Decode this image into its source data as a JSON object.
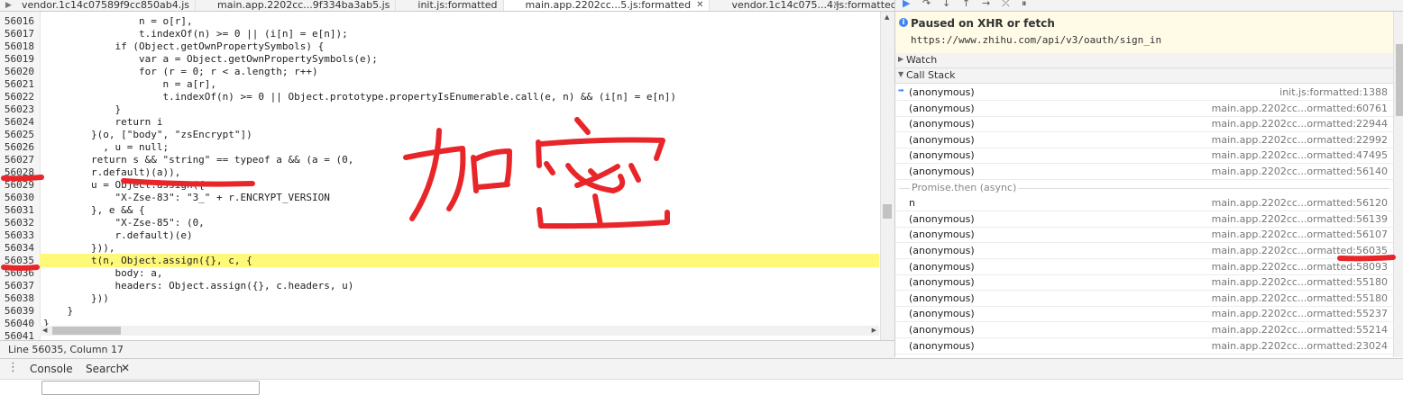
{
  "tabs": [
    {
      "label": "vendor.1c14c07589f9cc850ab4.js",
      "active": false
    },
    {
      "label": "main.app.2202cc...9f334ba3ab5.js",
      "active": false
    },
    {
      "label": "init.js:formatted",
      "active": false
    },
    {
      "label": "main.app.2202cc...5.js:formatted",
      "active": true
    },
    {
      "label": "vendor.1c14c075...4.js:formatted",
      "active": false
    }
  ],
  "code_lines": [
    {
      "num": "56016",
      "text": "                n = o[r],"
    },
    {
      "num": "56017",
      "text": "                t.indexOf(n) >= 0 || (i[n] = e[n]);"
    },
    {
      "num": "56018",
      "text": "            if (Object.getOwnPropertySymbols) {"
    },
    {
      "num": "56019",
      "text": "                var a = Object.getOwnPropertySymbols(e);"
    },
    {
      "num": "56020",
      "text": "                for (r = 0; r < a.length; r++)"
    },
    {
      "num": "56021",
      "text": "                    n = a[r],"
    },
    {
      "num": "56022",
      "text": "                    t.indexOf(n) >= 0 || Object.prototype.propertyIsEnumerable.call(e, n) && (i[n] = e[n])"
    },
    {
      "num": "56023",
      "text": "            }"
    },
    {
      "num": "56024",
      "text": "            return i"
    },
    {
      "num": "56025",
      "text": "        }(o, [\"body\", \"zsEncrypt\"])"
    },
    {
      "num": "56026",
      "text": "          , u = null;"
    },
    {
      "num": "56027",
      "text": "        return s && \"string\" == typeof a && (a = (0,"
    },
    {
      "num": "56028",
      "text": "        r.default)(a)),"
    },
    {
      "num": "56029",
      "text": "        u = Object.assign({"
    },
    {
      "num": "56030",
      "text": "            \"X-Zse-83\": \"3_\" + r.ENCRYPT_VERSION"
    },
    {
      "num": "56031",
      "text": "        }, e && {"
    },
    {
      "num": "56032",
      "text": "            \"X-Zse-85\": (0,"
    },
    {
      "num": "56033",
      "text": "            r.default)(e)"
    },
    {
      "num": "56034",
      "text": "        })),"
    },
    {
      "num": "56035",
      "text": "        t(n, Object.assign({}, c, {"
    },
    {
      "num": "56036",
      "text": "            body: a,"
    },
    {
      "num": "56037",
      "text": "            headers: Object.assign({}, c.headers, u)"
    },
    {
      "num": "56038",
      "text": "        }))"
    },
    {
      "num": "56039",
      "text": "    }"
    },
    {
      "num": "56040",
      "text": "}"
    },
    {
      "num": "56041",
      "text": ""
    }
  ],
  "highlight_line": "56035",
  "status_text": "Line 56035, Column 17",
  "paused": {
    "title": "Paused on XHR or fetch",
    "url": "https://www.zhihu.com/api/v3/oauth/sign_in"
  },
  "sections": {
    "watch": "Watch",
    "call_stack": "Call Stack"
  },
  "call_stack": [
    {
      "fn": "(anonymous)",
      "loc": "init.js:formatted:1388",
      "current": true
    },
    {
      "fn": "(anonymous)",
      "loc": "main.app.2202cc...ormatted:60761"
    },
    {
      "fn": "(anonymous)",
      "loc": "main.app.2202cc...ormatted:22944"
    },
    {
      "fn": "(anonymous)",
      "loc": "main.app.2202cc...ormatted:22992"
    },
    {
      "fn": "(anonymous)",
      "loc": "main.app.2202cc...ormatted:47495"
    },
    {
      "fn": "(anonymous)",
      "loc": "main.app.2202cc...ormatted:56140"
    },
    {
      "async": "Promise.then (async)"
    },
    {
      "fn": "n",
      "loc": "main.app.2202cc...ormatted:56120"
    },
    {
      "fn": "(anonymous)",
      "loc": "main.app.2202cc...ormatted:56139"
    },
    {
      "fn": "(anonymous)",
      "loc": "main.app.2202cc...ormatted:56107"
    },
    {
      "fn": "(anonymous)",
      "loc": "main.app.2202cc...ormatted:56035"
    },
    {
      "fn": "(anonymous)",
      "loc": "main.app.2202cc...ormatted:58093"
    },
    {
      "fn": "(anonymous)",
      "loc": "main.app.2202cc...ormatted:55180"
    },
    {
      "fn": "(anonymous)",
      "loc": "main.app.2202cc...ormatted:55180"
    },
    {
      "fn": "(anonymous)",
      "loc": "main.app.2202cc...ormatted:55237"
    },
    {
      "fn": "(anonymous)",
      "loc": "main.app.2202cc...ormatted:55214"
    },
    {
      "fn": "(anonymous)",
      "loc": "main.app.2202cc...ormatted:23024"
    }
  ],
  "drawer": {
    "console_label": "Console",
    "search_label": "Search"
  },
  "annotation": {
    "text": "加密",
    "color": "#e8262a"
  },
  "colors": {
    "highlight": "#fff97a",
    "paused_bg": "#fffbe6",
    "accent": "#4385f4"
  }
}
